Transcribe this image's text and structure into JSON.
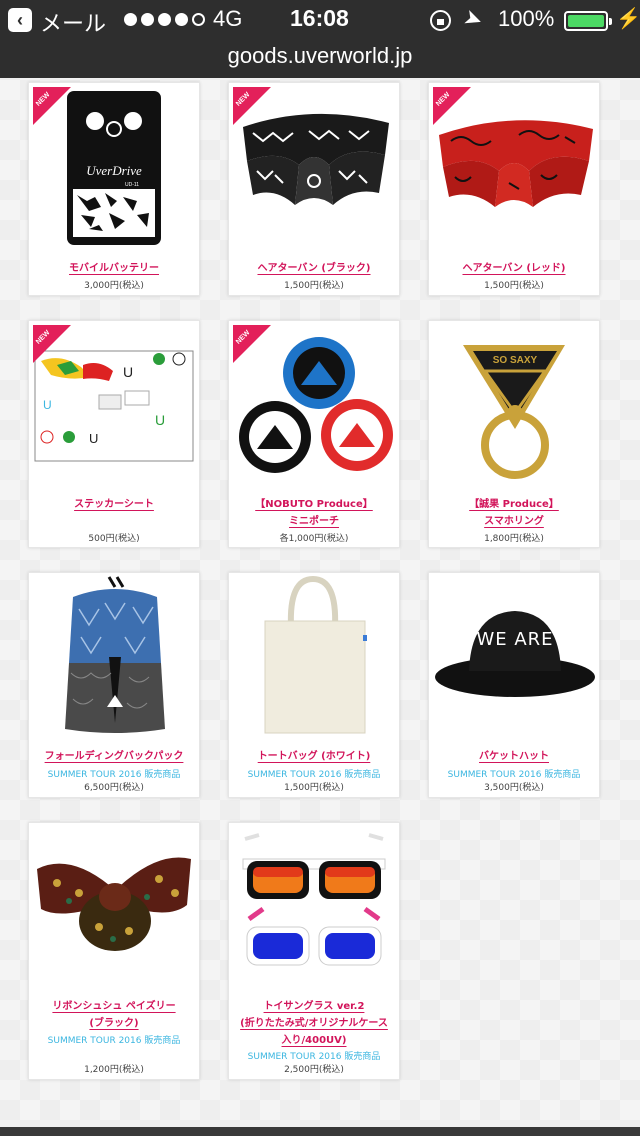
{
  "status_bar": {
    "back_label": "メール",
    "network": "4G",
    "time": "16:08",
    "battery_percent": "100%",
    "battery_level": 1.0,
    "signal_bars_filled": 4,
    "signal_bars_total": 5
  },
  "browser": {
    "url": "goods.uverworld.jp"
  },
  "colors": {
    "accent": "#d2145a",
    "ribbon": "#e3205a",
    "sub_text": "#3bb6e0",
    "status_bar": "#2e2e2e"
  },
  "badge_label": "NEW",
  "products": [
    {
      "name": "モバイルバッテリー",
      "price": "3,000円(税込)",
      "is_new": true
    },
    {
      "name": "ヘアターバン (ブラック)",
      "price": "1,500円(税込)",
      "is_new": true
    },
    {
      "name": "ヘアターバン (レッド)",
      "price": "1,500円(税込)",
      "is_new": true
    },
    {
      "name": "ステッカーシート",
      "price": "500円(税込)",
      "is_new": true
    },
    {
      "name_line1": "【NOBUTO Produce】",
      "name_line2": "ミニポーチ",
      "price": "各1,000円(税込)",
      "is_new": true
    },
    {
      "name_line1": "【誠果 Produce】",
      "name_line2": "スマホリング",
      "price": "1,800円(税込)",
      "is_new": false
    },
    {
      "name": "フォールディングバックパック",
      "sub": "SUMMER TOUR 2016 販売商品",
      "price": "6,500円(税込)",
      "is_new": false
    },
    {
      "name": "トートバッグ (ホワイト)",
      "sub": "SUMMER TOUR 2016 販売商品",
      "price": "1,500円(税込)",
      "is_new": false
    },
    {
      "name": "バケットハット",
      "sub": "SUMMER TOUR 2016 販売商品",
      "price": "3,500円(税込)",
      "is_new": false
    },
    {
      "name_line1": "リボンシュシュ ペイズリー",
      "name_line2": "(ブラック)",
      "sub": "SUMMER TOUR 2016 販売商品",
      "price": "1,200円(税込)",
      "is_new": false
    },
    {
      "name_line1": "トイサングラス ver.2",
      "name_line2": "(折りたたみ式/オリジナルケース",
      "name_line3": "入り/400UV)",
      "sub": "SUMMER TOUR 2016 販売商品",
      "price": "2,500円(税込)",
      "is_new": false
    }
  ],
  "image_text": {
    "pedal_brand": "UverDrive",
    "pedal_model": "UD-11",
    "hat_print": "WE ARE",
    "ring_text": "SO SAXY"
  }
}
